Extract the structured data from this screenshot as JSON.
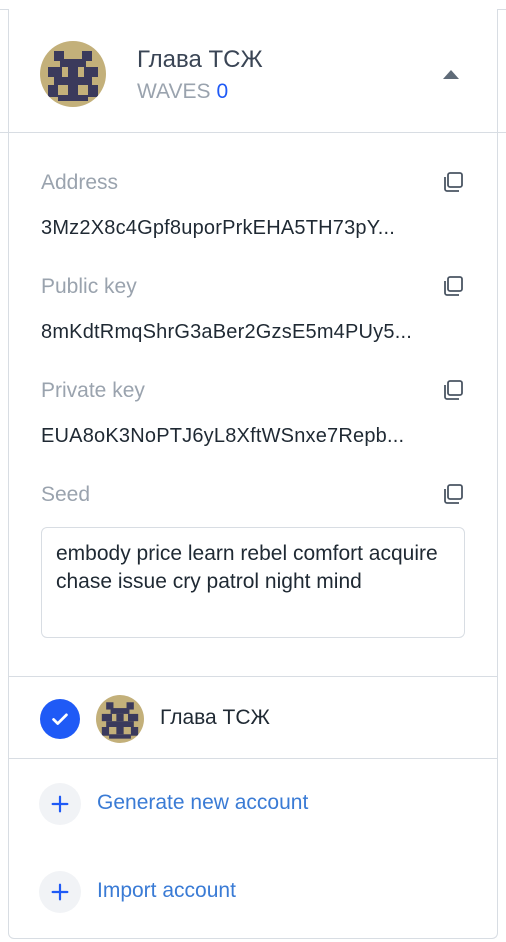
{
  "account": {
    "name": "Глава ТСЖ",
    "balance_currency": "WAVES",
    "balance_value": "0"
  },
  "fields": {
    "address": {
      "label": "Address",
      "value": "3Mz2X8c4Gpf8uporPrkEHA5TH73pY..."
    },
    "public_key": {
      "label": "Public key",
      "value": "8mKdtRmqShrG3aBer2GzsE5m4PUy5..."
    },
    "private_key": {
      "label": "Private key",
      "value": "EUA8oK3NoPTJ6yL8XftWSnxe7Repb..."
    },
    "seed": {
      "label": "Seed",
      "value": "embody price learn rebel comfort acquire chase issue cry patrol night mind"
    }
  },
  "accounts_list": [
    {
      "name": "Глава ТСЖ",
      "selected": true
    }
  ],
  "actions": {
    "generate_label": "Generate new account",
    "import_label": "Import account"
  },
  "colors": {
    "accent": "#1f5af6",
    "link": "#3a7bd5",
    "muted": "#9aa3ae",
    "avatar_dark": "#3b3a5c",
    "avatar_light": "#c3b07a"
  },
  "icons": {
    "copy": "copy-icon",
    "caret": "caret-up-icon",
    "check": "checkmark-icon",
    "plus": "plus-icon"
  }
}
